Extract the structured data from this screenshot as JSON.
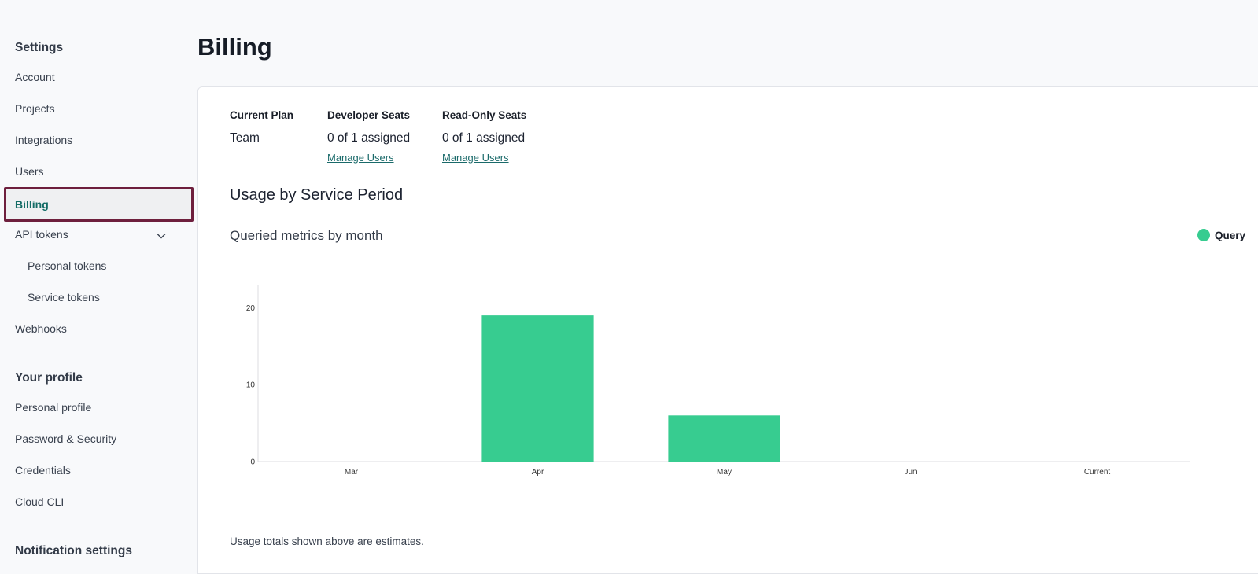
{
  "sidebar": {
    "settings_title": "Settings",
    "settings_items": [
      {
        "label": "Account"
      },
      {
        "label": "Projects"
      },
      {
        "label": "Integrations"
      },
      {
        "label": "Users"
      },
      {
        "label": "Billing",
        "active": true
      },
      {
        "label": "API tokens",
        "expanded": true
      },
      {
        "label": "Personal tokens",
        "sub": true
      },
      {
        "label": "Service tokens",
        "sub": true
      },
      {
        "label": "Webhooks"
      }
    ],
    "profile_title": "Your profile",
    "profile_items": [
      {
        "label": "Personal profile"
      },
      {
        "label": "Password & Security"
      },
      {
        "label": "Credentials"
      },
      {
        "label": "Cloud CLI"
      }
    ],
    "notification_title": "Notification settings"
  },
  "page": {
    "title": "Billing",
    "plan": {
      "current_plan_label": "Current Plan",
      "current_plan_value": "Team",
      "developer_seats_label": "Developer Seats",
      "developer_seats_value": "0 of 1 assigned",
      "developer_manage_link": "Manage Users",
      "readonly_seats_label": "Read-Only Seats",
      "readonly_seats_value": "0 of 1 assigned",
      "readonly_manage_link": "Manage Users"
    },
    "usage_title": "Usage by Service Period",
    "chart_title": "Queried metrics by month",
    "legend_label": "Query",
    "footnote": "Usage totals shown above are estimates."
  },
  "colors": {
    "accent": "#136c66",
    "bar": "#37cc90",
    "active_outline": "#6e1f3d"
  },
  "chart_data": {
    "type": "bar",
    "title": "Queried metrics by month",
    "categories": [
      "Mar",
      "Apr",
      "May",
      "Jun",
      "Current"
    ],
    "series": [
      {
        "name": "Query",
        "values": [
          0,
          19,
          6,
          0,
          0
        ]
      }
    ],
    "yticks": [
      0,
      10,
      20
    ],
    "ylim": [
      0,
      23
    ],
    "xlabel": "",
    "ylabel": "",
    "legend": "top-right",
    "grid": false
  }
}
